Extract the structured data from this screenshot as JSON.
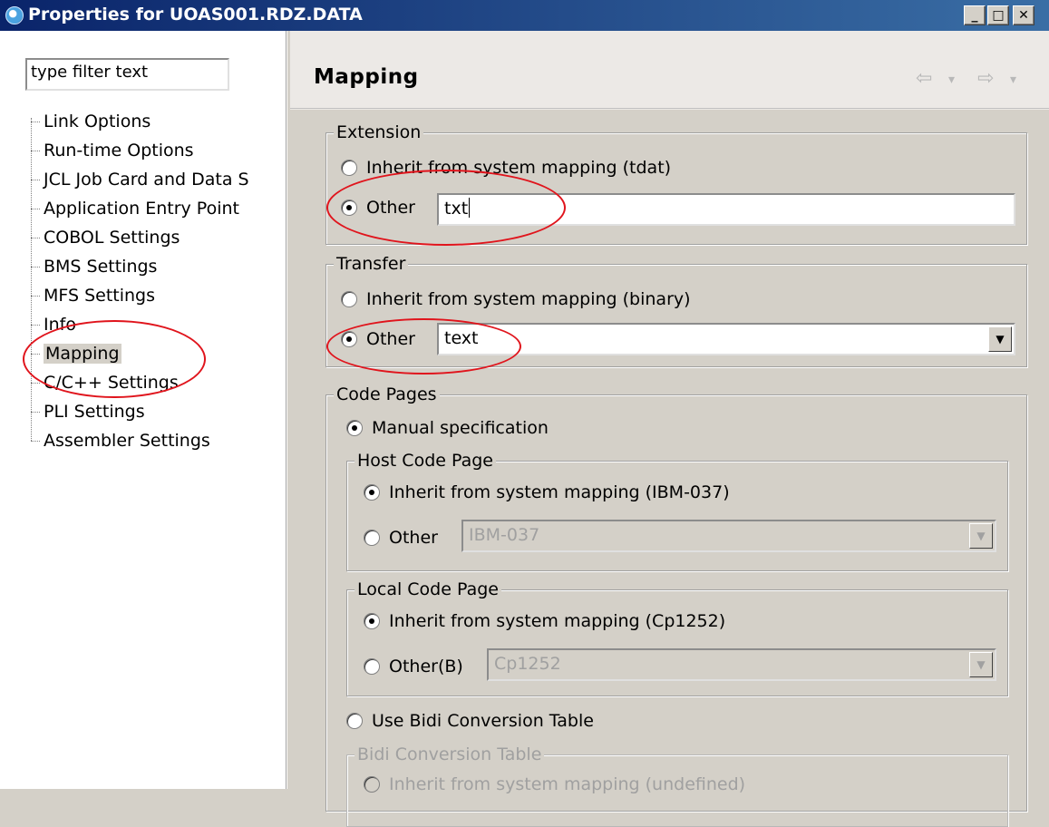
{
  "window": {
    "title": "Properties for UOAS001.RDZ.DATA",
    "buttons": {
      "minimize": "_",
      "maximize": "□",
      "close": "✕"
    }
  },
  "sidebar": {
    "filter_placeholder": "type filter text",
    "items": [
      {
        "label": "Link Options"
      },
      {
        "label": "Run-time Options"
      },
      {
        "label": "JCL Job Card and Data S"
      },
      {
        "label": "Application Entry Point"
      },
      {
        "label": "COBOL Settings"
      },
      {
        "label": "BMS Settings"
      },
      {
        "label": "MFS Settings"
      },
      {
        "label": "Info"
      },
      {
        "label": "Mapping",
        "selected": true
      },
      {
        "label": "C/C++ Settings"
      },
      {
        "label": "PLI Settings"
      },
      {
        "label": "Assembler Settings"
      }
    ]
  },
  "page": {
    "title": "Mapping",
    "nav": {
      "back": "⇦",
      "back_menu": "▾",
      "forward": "⇨",
      "forward_menu": "▾"
    }
  },
  "extension": {
    "legend": "Extension",
    "inherit_label": "Inherit from system mapping (tdat)",
    "other_label": "Other",
    "other_value": "txt",
    "selected": "other"
  },
  "transfer": {
    "legend": "Transfer",
    "inherit_label": "Inherit from system mapping (binary)",
    "other_label": "Other",
    "other_value": "text",
    "selected": "other"
  },
  "code_pages": {
    "legend": "Code Pages",
    "manual_label": "Manual specification",
    "host": {
      "legend": "Host Code Page",
      "inherit_label": "Inherit from system mapping (IBM-037)",
      "other_label": "Other",
      "other_value": "IBM-037"
    },
    "local": {
      "legend": "Local Code Page",
      "inherit_label": "Inherit from system mapping (Cp1252)",
      "other_label": "Other(B)",
      "other_value": "Cp1252"
    },
    "bidi_label": "Use Bidi Conversion Table",
    "bidi_table": {
      "legend": "Bidi Conversion Table",
      "inherit_label": "Inherit from system mapping (undefined)"
    }
  },
  "colors": {
    "annotation": "#e0141c",
    "title_bar": "#0a246a"
  }
}
